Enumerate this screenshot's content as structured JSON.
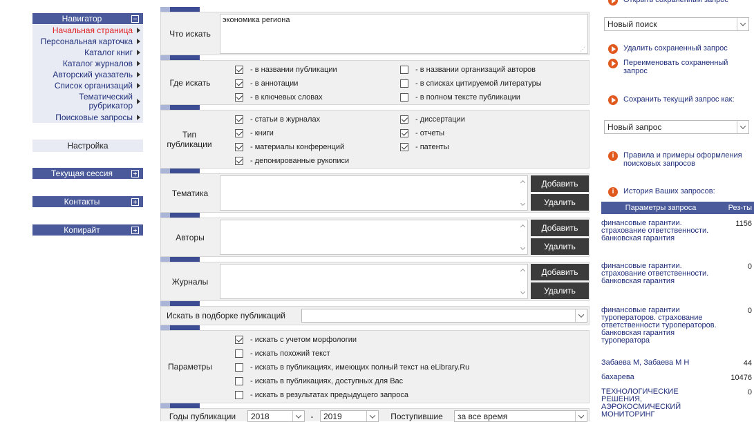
{
  "nav": {
    "navigator_title": "Навигатор",
    "items": [
      {
        "label": "Начальная страница",
        "active": true
      },
      {
        "label": "Персональная карточка"
      },
      {
        "label": "Каталог книг"
      },
      {
        "label": "Каталог журналов"
      },
      {
        "label": "Авторский указатель"
      },
      {
        "label": "Список организаций"
      },
      {
        "label": "Тематический рубрикатор"
      },
      {
        "label": "Поисковые запросы"
      }
    ],
    "setup": "Настройка",
    "session": "Текущая сессия",
    "contacts": "Контакты",
    "copyright": "Копирайт"
  },
  "form": {
    "what_label": "Что искать",
    "what_value": "экономика региона",
    "where_label": "Где искать",
    "where_options": [
      {
        "label": "- в названии публикации",
        "checked": true
      },
      {
        "label": "- в аннотации",
        "checked": true
      },
      {
        "label": "- в ключевых словах",
        "checked": true
      },
      {
        "label": "- в названии организаций авторов",
        "checked": false
      },
      {
        "label": "- в списках цитируемой литературы",
        "checked": false
      },
      {
        "label": "- в полном тексте публикации",
        "checked": false
      }
    ],
    "type_label": "Тип публикации",
    "type_options": [
      {
        "label": "- статьи в журналах",
        "checked": true
      },
      {
        "label": "- книги",
        "checked": true
      },
      {
        "label": "- материалы конференций",
        "checked": true
      },
      {
        "label": "- депонированные рукописи",
        "checked": true
      },
      {
        "label": "- диссертации",
        "checked": true
      },
      {
        "label": "- отчеты",
        "checked": true
      },
      {
        "label": "- патенты",
        "checked": true
      }
    ],
    "topic_label": "Тематика",
    "authors_label": "Авторы",
    "journals_label": "Журналы",
    "add_label": "Добавить",
    "delete_label": "Удалить",
    "collection_label": "Искать в подборке публикаций",
    "params_label": "Параметры",
    "params_options": [
      {
        "label": "- искать с учетом морфологии",
        "checked": true
      },
      {
        "label": "- искать похожий текст",
        "checked": false
      },
      {
        "label": "- искать в публикациях, имеющих полный текст на eLibrary.Ru",
        "checked": false
      },
      {
        "label": "- искать в публикациях, доступных для Вас",
        "checked": false
      },
      {
        "label": "- искать в результатах предыдущего запроса",
        "checked": false
      }
    ],
    "years_label": "Годы публикации",
    "year_from": "2018",
    "year_sep": "-",
    "year_to": "2019",
    "received_label": "Поступившие",
    "received_value": "за все время"
  },
  "right": {
    "top_link": "Открыть сохраненный запрос",
    "saved_select": "Новый поиск",
    "delete_saved": "Удалить сохраненный запрос",
    "rename_saved": "Переименовать сохраненный запрос",
    "save_current": "Сохранить текущий запрос как:",
    "new_query_select": "Новый запрос",
    "rules_link": "Правила и примеры оформления поисковых запросов",
    "history_title": "История Ваших запросов:",
    "col_params": "Параметры запроса",
    "col_results": "Рез-ты",
    "history": [
      {
        "q": "финансовые гарантии. страхование ответственности. банковская гарантия",
        "n": "1156"
      },
      {
        "q": "финансовые гарантии. страхование ответственности. банковская гарантия",
        "n": "0"
      },
      {
        "q": "финансовые гарантии туроператоров. страхование ответственности туроператоров. банковская гарантия туроператора",
        "n": "0"
      },
      {
        "q": "Забаева М, Забаева М Н",
        "n": "44"
      },
      {
        "q": "бахарева",
        "n": "10476"
      },
      {
        "q": "ТЕХНОЛОГИЧЕСКИЕ РЕШЕНИЯ, АЭРОКОСМИЧЕСКИЙ МОНИТОРИНГ",
        "n": "0"
      }
    ]
  }
}
